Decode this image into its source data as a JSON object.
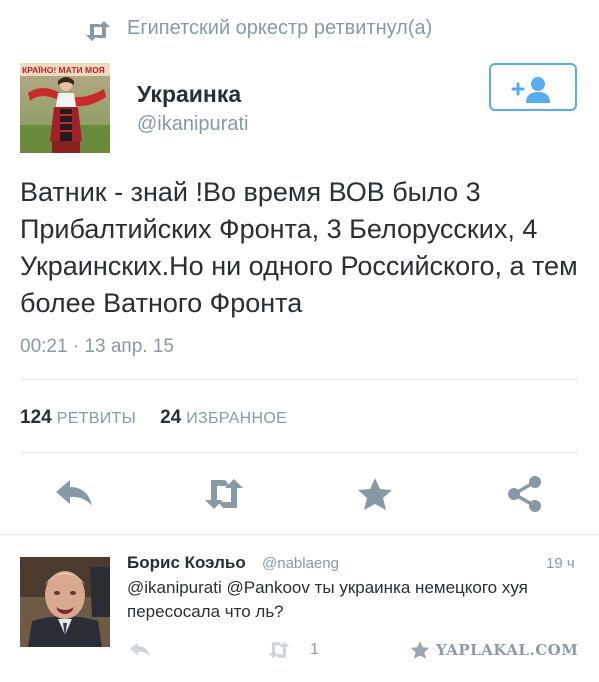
{
  "retweet_context": {
    "text": "Египетский оркестр ретвитнул(а)",
    "icon": "retweet-icon"
  },
  "tweet": {
    "author_name": "Украинка",
    "author_handle": "@ikanipurati",
    "avatar_banner": "КРАЇНО! МАТИ МОЯ",
    "follow_icon": "follow-user-icon",
    "text": "Ватник - знай !Во время ВОВ было 3 Прибалтийских Фронта, 3 Белорусских, 4 Украинских.Но ни одного Российского, а тем более Ватного Фронта",
    "timestamp": "00:21 · 13 апр. 15",
    "retweets_count": "124",
    "retweets_label": "РЕТВИТЫ",
    "favorites_count": "24",
    "favorites_label": "ИЗБРАННОЕ",
    "actions": [
      "reply-icon",
      "retweet-icon",
      "favorite-icon",
      "share-icon"
    ]
  },
  "reply": {
    "author_name": "Борис Коэльо",
    "author_handle": "@nablaeng",
    "time": "19 ч",
    "text": "@ikanipurati @Pankoov ты украинка немецкого хуя пересосала что ль?",
    "retweet_count": "1"
  },
  "watermark": "YAPLAKAL.COM",
  "colors": {
    "accent": "#55acee",
    "muted": "#8899a6",
    "icon": "#8899a6",
    "text": "#292f33",
    "divider": "#e1e8ed"
  }
}
